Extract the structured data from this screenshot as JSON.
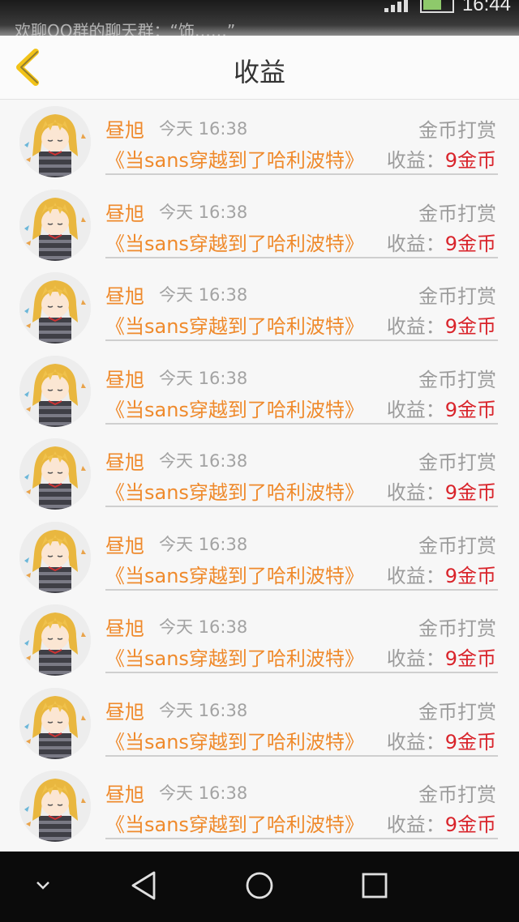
{
  "status_bar": {
    "ticker_text": "欢聊QQ群的聊天群：“饰……”",
    "time": "16:44"
  },
  "header": {
    "title": "收益"
  },
  "records": [
    {
      "user": "昼旭",
      "time": "今天 16:38",
      "type": "金币打赏",
      "work": "《当sans穿越到了哈利波特》",
      "income_label": "收益：",
      "income_amount": "9金币"
    },
    {
      "user": "昼旭",
      "time": "今天 16:38",
      "type": "金币打赏",
      "work": "《当sans穿越到了哈利波特》",
      "income_label": "收益：",
      "income_amount": "9金币"
    },
    {
      "user": "昼旭",
      "time": "今天 16:38",
      "type": "金币打赏",
      "work": "《当sans穿越到了哈利波特》",
      "income_label": "收益：",
      "income_amount": "9金币"
    },
    {
      "user": "昼旭",
      "time": "今天 16:38",
      "type": "金币打赏",
      "work": "《当sans穿越到了哈利波特》",
      "income_label": "收益：",
      "income_amount": "9金币"
    },
    {
      "user": "昼旭",
      "time": "今天 16:38",
      "type": "金币打赏",
      "work": "《当sans穿越到了哈利波特》",
      "income_label": "收益：",
      "income_amount": "9金币"
    },
    {
      "user": "昼旭",
      "time": "今天 16:38",
      "type": "金币打赏",
      "work": "《当sans穿越到了哈利波特》",
      "income_label": "收益：",
      "income_amount": "9金币"
    },
    {
      "user": "昼旭",
      "time": "今天 16:38",
      "type": "金币打赏",
      "work": "《当sans穿越到了哈利波特》",
      "income_label": "收益：",
      "income_amount": "9金币"
    },
    {
      "user": "昼旭",
      "time": "今天 16:38",
      "type": "金币打赏",
      "work": "《当sans穿越到了哈利波特》",
      "income_label": "收益：",
      "income_amount": "9金币"
    },
    {
      "user": "昼旭",
      "time": "今天 16:38",
      "type": "金币打赏",
      "work": "《当sans穿越到了哈利波特》",
      "income_label": "收益：",
      "income_amount": "9金币"
    }
  ],
  "icons": {
    "back": "chevron-left-icon",
    "avatar": "anime-avatar",
    "nav": [
      "chevron-down-icon",
      "triangle-back-icon",
      "circle-home-icon",
      "square-recents-icon"
    ]
  },
  "colors": {
    "accent": "#ef8a2c",
    "amount": "#d9242b",
    "muted": "#9c9c9c"
  }
}
